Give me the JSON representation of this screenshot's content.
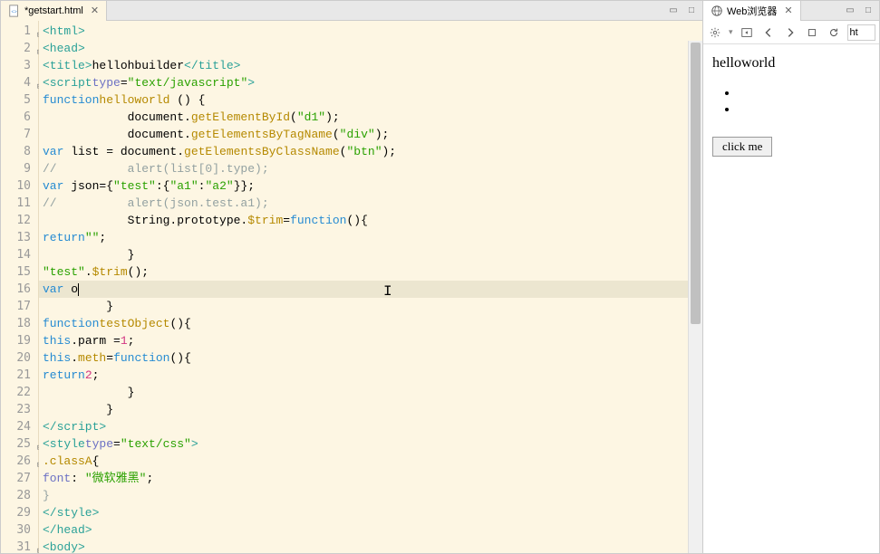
{
  "editor": {
    "tab_title": "*getstart.html",
    "lines": [
      {
        "num": 1,
        "fold": true,
        "html": "<span class='tok-tag'>&lt;html&gt;</span>"
      },
      {
        "num": 2,
        "fold": true,
        "html": "   <span class='tok-tag'>&lt;head&gt;</span>"
      },
      {
        "num": 3,
        "fold": false,
        "html": "      <span class='tok-tag'>&lt;title&gt;</span>hellohbuilder<span class='tok-tag'>&lt;/title&gt;</span>"
      },
      {
        "num": 4,
        "fold": true,
        "html": "      <span class='tok-tag'>&lt;script</span> <span class='tok-attr'>type</span>=<span class='tok-str'>\"text/javascript\"</span><span class='tok-tag'>&gt;</span>"
      },
      {
        "num": 5,
        "fold": false,
        "html": "         <span class='tok-kw'>function</span> <span class='tok-fn'>helloworld</span> () {"
      },
      {
        "num": 6,
        "fold": false,
        "html": "            document.<span class='tok-fn'>getElementById</span>(<span class='tok-str'>\"d1\"</span>);"
      },
      {
        "num": 7,
        "fold": false,
        "html": "            document.<span class='tok-fn'>getElementsByTagName</span>(<span class='tok-str'>\"div\"</span>);"
      },
      {
        "num": 8,
        "fold": false,
        "html": "            <span class='tok-kw'>var</span> list = document.<span class='tok-fn'>getElementsByClassName</span>(<span class='tok-str'>\"btn\"</span>);"
      },
      {
        "num": 9,
        "fold": false,
        "html": "<span class='tok-comment'>//          alert(list[0].type);</span>"
      },
      {
        "num": 10,
        "fold": false,
        "html": "            <span class='tok-kw'>var</span> json={<span class='tok-str'>\"test\"</span>:{<span class='tok-str'>\"a1\"</span>:<span class='tok-str'>\"a2\"</span>}};"
      },
      {
        "num": 11,
        "fold": false,
        "html": "<span class='tok-comment'>//          alert(json.test.a1);</span>"
      },
      {
        "num": 12,
        "fold": false,
        "html": "            String.prototype.<span class='tok-fn'>$trim</span>=<span class='tok-kw'>function</span>(){"
      },
      {
        "num": 13,
        "fold": false,
        "html": "               <span class='tok-kw'>return</span> <span class='tok-str'>\"\"</span>;"
      },
      {
        "num": 14,
        "fold": false,
        "html": "            }"
      },
      {
        "num": 15,
        "fold": false,
        "html": "            <span class='tok-str'>\"test\"</span>.<span class='tok-fn'>$trim</span>();"
      },
      {
        "num": 16,
        "fold": false,
        "html": "            <span class='tok-kw'>var</span> o",
        "current": true
      },
      {
        "num": 17,
        "fold": false,
        "html": "         }"
      },
      {
        "num": 18,
        "fold": false,
        "html": "         <span class='tok-kw'>function</span> <span class='tok-fn'>testObject</span>(){"
      },
      {
        "num": 19,
        "fold": false,
        "html": "            <span class='tok-kw'>this</span>.parm =<span class='tok-num'>1</span>;"
      },
      {
        "num": 20,
        "fold": false,
        "html": "            <span class='tok-kw'>this</span>.<span class='tok-fn'>meth</span>=<span class='tok-kw'>function</span>(){"
      },
      {
        "num": 21,
        "fold": false,
        "html": "               <span class='tok-kw'>return</span> <span class='tok-num'>2</span>;"
      },
      {
        "num": 22,
        "fold": false,
        "html": "            }"
      },
      {
        "num": 23,
        "fold": false,
        "html": "         }"
      },
      {
        "num": 24,
        "fold": false,
        "html": "      <span class='tok-tag'>&lt;/script&gt;</span>"
      },
      {
        "num": 25,
        "fold": true,
        "html": "      <span class='tok-tag'>&lt;style</span> <span class='tok-attr'>type</span>=<span class='tok-str'>\"text/css\"</span><span class='tok-tag'>&gt;</span>"
      },
      {
        "num": 26,
        "fold": true,
        "html": "         <span class='tok-fn'>.classA</span>{"
      },
      {
        "num": 27,
        "fold": false,
        "html": "            <span class='tok-attr'>font</span>: <span class='tok-str'>\"微软雅黑\"</span>;"
      },
      {
        "num": 28,
        "fold": false,
        "html": "         <span class='tok-comment'>}</span>"
      },
      {
        "num": 29,
        "fold": false,
        "html": "      <span class='tok-tag'>&lt;/style&gt;</span>"
      },
      {
        "num": 30,
        "fold": false,
        "html": "   <span class='tok-tag'>&lt;/head&gt;</span>"
      },
      {
        "num": 31,
        "fold": true,
        "html": "   <span class='tok-tag'>&lt;body&gt;</span>"
      }
    ]
  },
  "browser": {
    "tab_title": "Web浏览器",
    "url_value": "ht",
    "heading": "helloworld",
    "button_label": "click me"
  }
}
